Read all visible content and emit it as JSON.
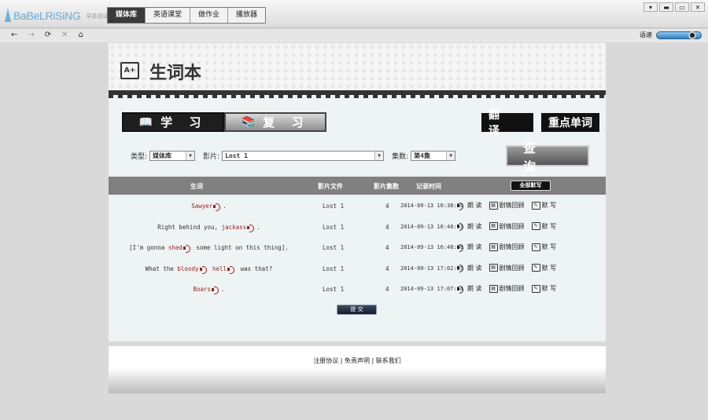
{
  "app": {
    "logo_text": "BaBeLRiSiNG",
    "logo_sub": "早英语译 · 科技"
  },
  "top_tabs": [
    {
      "label": "媒体库",
      "active": true
    },
    {
      "label": "英语课堂",
      "active": false
    },
    {
      "label": "做作业",
      "active": false
    },
    {
      "label": "播放器",
      "active": false
    }
  ],
  "window_controls": {
    "menu": "▾",
    "minimize": "▬",
    "maximize": "▭",
    "close": "✕"
  },
  "nav": {
    "back": "←",
    "forward": "→",
    "refresh": "⟳",
    "stop": "✕",
    "home": "⌂",
    "speed_label": "语速",
    "speed_level": 0.8
  },
  "page": {
    "icon_text": "A+",
    "title": "生词本",
    "tab_study": "学 习",
    "tab_review": "复 习",
    "btn_translate": "翻 译",
    "btn_keywords": "重点单词"
  },
  "filters": {
    "type_label": "类型:",
    "type_value": "媒体库",
    "movie_label": "影片:",
    "movie_value": "Lost 1",
    "episode_label": "集数:",
    "episode_value": "第4集",
    "query_button": "查 询"
  },
  "table": {
    "headers": {
      "word": "生词",
      "file": "影片文件",
      "episode": "影片集数",
      "time": "记录时间",
      "all_known": "全部默写"
    },
    "rows": [
      {
        "parts": [
          {
            "t": "",
            "h": false
          },
          {
            "t": "Sawyer",
            "h": true,
            "s": true
          },
          {
            "t": ".",
            "h": false
          }
        ],
        "file": "Lost 1",
        "episode": "4",
        "time": "2014-09-13 16:38:50"
      },
      {
        "parts": [
          {
            "t": "Right behind you, ",
            "h": false
          },
          {
            "t": "jackass",
            "h": true,
            "s": true
          },
          {
            "t": ".",
            "h": false
          }
        ],
        "file": "Lost 1",
        "episode": "4",
        "time": "2014-09-13 16:40:53"
      },
      {
        "parts": [
          {
            "t": "[I'm gonna ",
            "h": false
          },
          {
            "t": "shed",
            "h": true,
            "s": true
          },
          {
            "t": " some light on this thing].",
            "h": false
          }
        ],
        "file": "Lost 1",
        "episode": "4",
        "time": "2014-09-13 16:48:30"
      },
      {
        "parts": [
          {
            "t": "What the ",
            "h": false
          },
          {
            "t": "bloody",
            "h": true,
            "s": true
          },
          {
            "t": " ",
            "h": false
          },
          {
            "t": "hell",
            "h": true,
            "s": true
          },
          {
            "t": " was that?",
            "h": false
          }
        ],
        "file": "Lost 1",
        "episode": "4",
        "time": "2014-09-13 17:02:55"
      },
      {
        "parts": [
          {
            "t": "",
            "h": false
          },
          {
            "t": "Boars",
            "h": true,
            "s": true
          },
          {
            "t": ".",
            "h": false
          }
        ],
        "file": "Lost 1",
        "episode": "4",
        "time": "2014-09-13 17:07:54"
      }
    ],
    "actions": {
      "read": "朗 读",
      "review": "剧情回顾",
      "write": "默 写"
    }
  },
  "submit_label": "提 交",
  "footer": {
    "agreement": "注册协议",
    "sep": "|",
    "disclaimer": "免责声明",
    "contact": "联系我们"
  }
}
